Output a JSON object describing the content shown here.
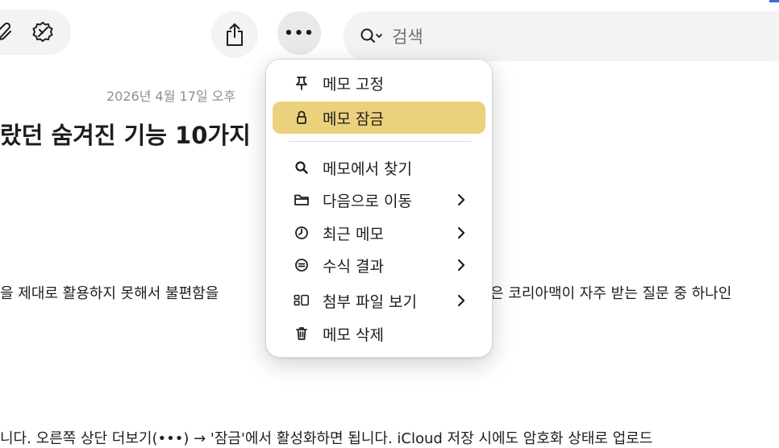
{
  "toolbar": {
    "icons": [
      "attachment-icon",
      "checklist-edit-icon",
      "share-icon",
      "more-icon"
    ],
    "more_label": "•••"
  },
  "search": {
    "placeholder": "검색"
  },
  "note": {
    "date": "2026년 4월 17일 오후",
    "title": "랐던 숨겨진 기능 10가지",
    "line1_left": "을 제대로 활용하지 못해서 불편함을",
    "line1_right": "은 코리아맥이 자주 받는 질문 중 하나인",
    "line2": "니다. 오른쪽 상단 더보기(•••) → '잠금'에서 활성화하면 됩니다. iCloud 저장 시에도 암호화 상태로 업로드"
  },
  "menu": {
    "items": [
      {
        "label": "메모 고정",
        "icon": "pin-icon",
        "submenu": false,
        "selected": false
      },
      {
        "label": "메모 잠금",
        "icon": "lock-icon",
        "submenu": false,
        "selected": true
      },
      {
        "label": "메모에서 찾기",
        "icon": "magnifier-icon",
        "submenu": false,
        "selected": false
      },
      {
        "label": "다음으로 이동",
        "icon": "folder-icon",
        "submenu": true,
        "selected": false
      },
      {
        "label": "최근 메모",
        "icon": "clock-icon",
        "submenu": true,
        "selected": false
      },
      {
        "label": "수식 결과",
        "icon": "equals-circle-icon",
        "submenu": true,
        "selected": false
      },
      {
        "label": "첨부 파일 보기",
        "icon": "attachments-grid-icon",
        "submenu": true,
        "selected": false
      },
      {
        "label": "메모 삭제",
        "icon": "trash-icon",
        "submenu": false,
        "selected": false
      }
    ],
    "chevron": ">"
  },
  "colors": {
    "highlight": "#ecd17c",
    "accent": "#3a6fd8"
  }
}
